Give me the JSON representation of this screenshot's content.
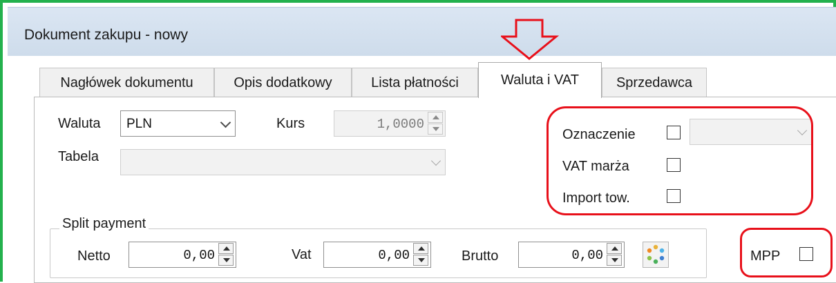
{
  "window": {
    "title": "Dokument zakupu - nowy"
  },
  "tabs": [
    {
      "label": "Nagłówek dokumentu"
    },
    {
      "label": "Opis dodatkowy"
    },
    {
      "label": "Lista płatności"
    },
    {
      "label": "Waluta i VAT"
    },
    {
      "label": "Sprzedawca"
    }
  ],
  "currency": {
    "label": "Waluta",
    "value": "PLN",
    "rate_label": "Kurs",
    "rate_value": "1,0000",
    "table_label": "Tabela",
    "table_value": ""
  },
  "flags": {
    "marking_label": "Oznaczenie",
    "marking_value": "",
    "vat_margin_label": "VAT marża",
    "import_label": "Import tow."
  },
  "split_payment": {
    "title": "Split payment",
    "netto_label": "Netto",
    "netto_value": "0,00",
    "vat_label": "Vat",
    "vat_value": "0,00",
    "brutto_label": "Brutto",
    "brutto_value": "0,00",
    "mpp_label": "MPP"
  },
  "colors": {
    "frame": "#23b14d",
    "annotation": "#e8101a",
    "titlebar": "#d6e2ef"
  }
}
